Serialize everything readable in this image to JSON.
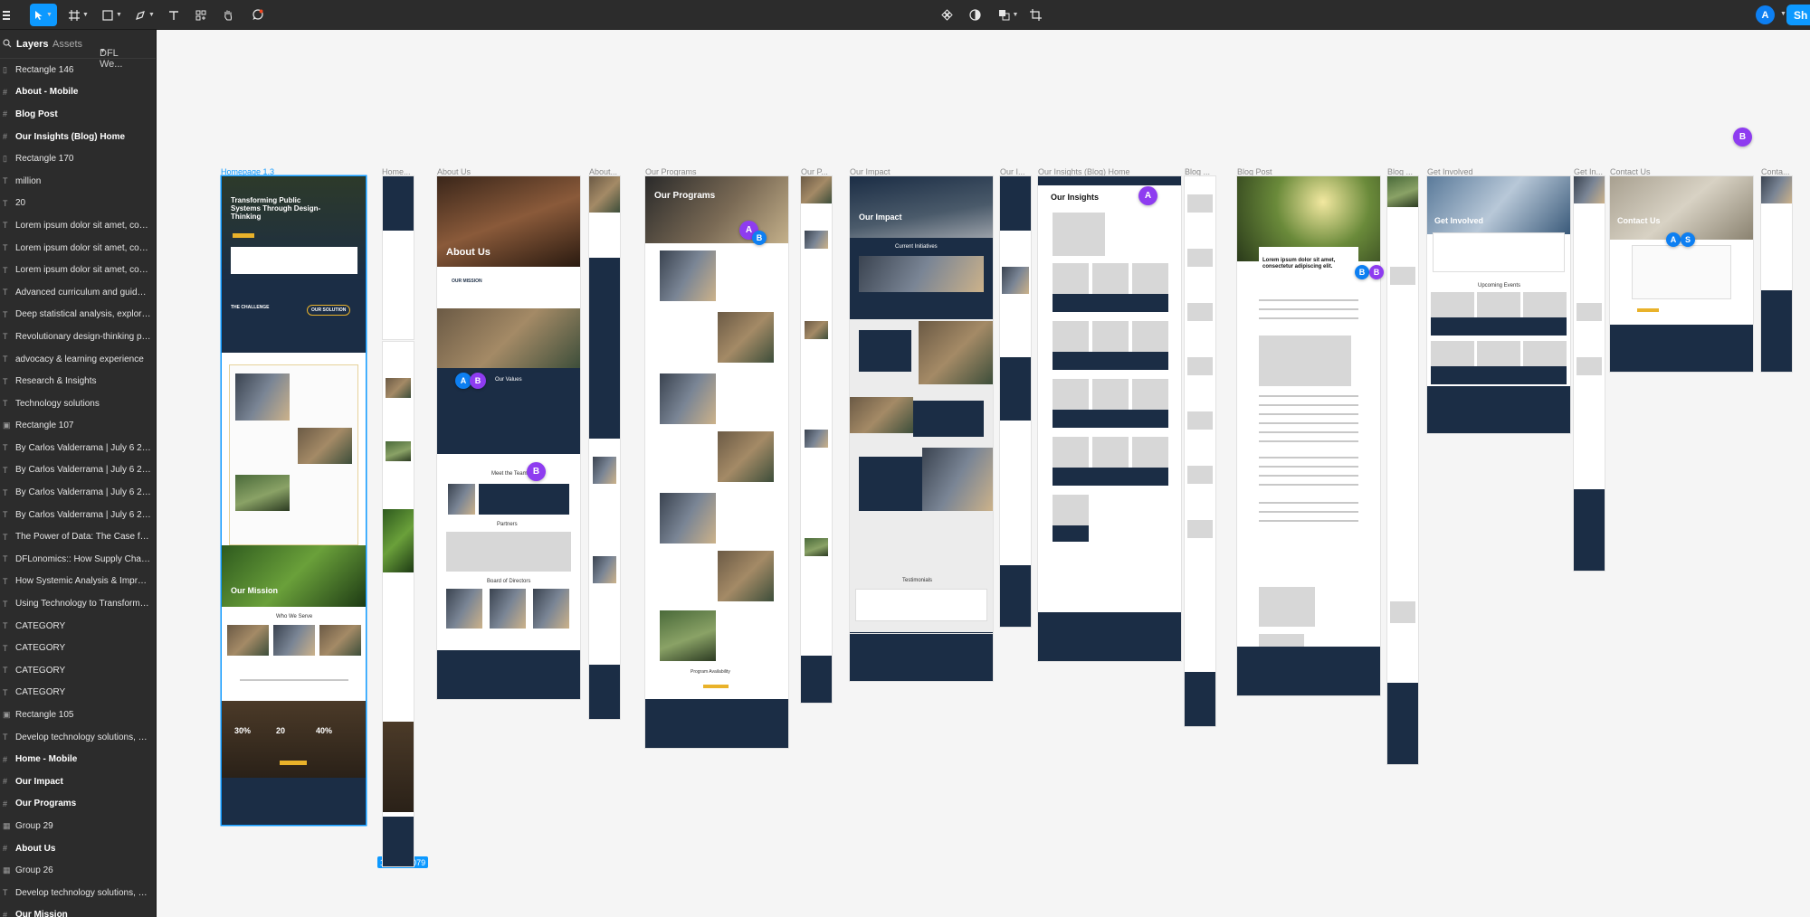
{
  "colors": {
    "accent": "#0d99ff",
    "navy": "#1b2d45",
    "gold": "#e9b22a",
    "collab_b": "#8e3cf0",
    "collab_a": "#0d7ff2"
  },
  "toolbar": {
    "menu_icon": "figma-menu-icon",
    "tools": [
      "move-tool-icon",
      "frame-tool-icon",
      "shape-tool-icon",
      "pen-tool-icon",
      "text-tool-icon",
      "resources-icon",
      "hand-tool-icon",
      "comment-icon"
    ],
    "center_tools": [
      "component-icon",
      "theme-icon",
      "boolean-icon",
      "crop-icon"
    ],
    "user_avatar": "A",
    "share_label": "Sh"
  },
  "sidebar": {
    "tabs": {
      "layers": "Layers",
      "assets": "Assets",
      "page": "DFL We..."
    },
    "layers": [
      {
        "icon": "rect",
        "label": "Rectangle 146"
      },
      {
        "icon": "frame",
        "label": "About - Mobile"
      },
      {
        "icon": "frame",
        "label": "Blog Post"
      },
      {
        "icon": "frame",
        "label": "Our Insights (Blog) Home"
      },
      {
        "icon": "rect",
        "label": "Rectangle 170"
      },
      {
        "icon": "text",
        "label": "million"
      },
      {
        "icon": "text",
        "label": "20"
      },
      {
        "icon": "text",
        "label": "Lorem ipsum dolor sit amet, conse..."
      },
      {
        "icon": "text",
        "label": "Lorem ipsum dolor sit amet, conse..."
      },
      {
        "icon": "text",
        "label": "Lorem ipsum dolor sit amet, conse..."
      },
      {
        "icon": "text",
        "label": "Advanced curriculum and guidance"
      },
      {
        "icon": "text",
        "label": "Deep statistical analysis, explorati..."
      },
      {
        "icon": "text",
        "label": "Revolutionary design-thinking pow..."
      },
      {
        "icon": "text",
        "label": "advocacy & learning experience"
      },
      {
        "icon": "text",
        "label": "Research & Insights"
      },
      {
        "icon": "text",
        "label": "Technology solutions"
      },
      {
        "icon": "image",
        "label": "Rectangle 107"
      },
      {
        "icon": "text",
        "label": "By Carlos Valderrama | July 6 2023"
      },
      {
        "icon": "text",
        "label": "By Carlos Valderrama | July 6 2023"
      },
      {
        "icon": "text",
        "label": "By Carlos Valderrama | July 6 2023"
      },
      {
        "icon": "text",
        "label": "By Carlos Valderrama | July 6 2023"
      },
      {
        "icon": "text",
        "label": "The Power of Data: The Case for B..."
      },
      {
        "icon": "text",
        "label": "DFLonomics:: How Supply Chains i..."
      },
      {
        "icon": "text",
        "label": "How Systemic Analysis & Improve..."
      },
      {
        "icon": "text",
        "label": "Using Technology to Transform th..."
      },
      {
        "icon": "text",
        "label": "CATEGORY"
      },
      {
        "icon": "text",
        "label": "CATEGORY"
      },
      {
        "icon": "text",
        "label": "CATEGORY"
      },
      {
        "icon": "text",
        "label": "CATEGORY"
      },
      {
        "icon": "image",
        "label": "Rectangle 105"
      },
      {
        "icon": "text",
        "label": "Develop technology solutions, und..."
      },
      {
        "icon": "frame",
        "label": "Home - Mobile"
      },
      {
        "icon": "frame",
        "label": "Our Impact"
      },
      {
        "icon": "frame",
        "label": "Our Programs"
      },
      {
        "icon": "group",
        "label": "Group 29"
      },
      {
        "icon": "frame",
        "label": "About Us"
      },
      {
        "icon": "group",
        "label": "Group 26"
      },
      {
        "icon": "text",
        "label": "Develop technology solutions, und..."
      },
      {
        "icon": "frame",
        "label": "Our Mission"
      }
    ]
  },
  "canvas": {
    "frames": [
      {
        "label": "Homepage 1.3",
        "selected": true
      },
      {
        "label": "Home..."
      },
      {
        "label": "About Us"
      },
      {
        "label": "About..."
      },
      {
        "label": "Our Programs"
      },
      {
        "label": "Our P..."
      },
      {
        "label": "Our Impact"
      },
      {
        "label": "Our I..."
      },
      {
        "label": "Our Insights (Blog) Home"
      },
      {
        "label": "Blog ..."
      },
      {
        "label": "Blog Post"
      },
      {
        "label": "Blog ..."
      },
      {
        "label": "Get Involved"
      },
      {
        "label": "Get In..."
      },
      {
        "label": "Contact Us"
      },
      {
        "label": "Conta..."
      }
    ],
    "selection_size": "1776 × 8079",
    "home": {
      "hero_title": "Transforming Public Systems Through Design-Thinking",
      "challenge": "THE CHALLENGE",
      "solution": "OUR SOLUTION",
      "mission": "Our Mission",
      "who_we_serve": "Who We Serve",
      "stat1": "30%",
      "stat2": "20",
      "stat3": "40%"
    },
    "about": {
      "title": "About Us",
      "mission": "OUR MISSION",
      "values": "Our Values",
      "team": "Meet the Team",
      "partners": "Partners",
      "board": "Board of Directors"
    },
    "programs": {
      "title": "Our Programs",
      "availability": "Program Availability"
    },
    "impact": {
      "title": "Our Impact",
      "initiatives": "Current Initiatives",
      "testimonials": "Testimonials"
    },
    "insights": {
      "title": "Our Insights"
    },
    "blog": {
      "headline": "Lorem ipsum dolor sit amet, consectetur adipiscing elit."
    },
    "involved": {
      "title": "Get Involved",
      "events": "Upcoming Events"
    },
    "contact": {
      "title": "Contact Us"
    },
    "collaborators": [
      "B",
      "A",
      "B",
      "A",
      "B",
      "B",
      "A",
      "B",
      "A",
      "S",
      "B"
    ]
  }
}
